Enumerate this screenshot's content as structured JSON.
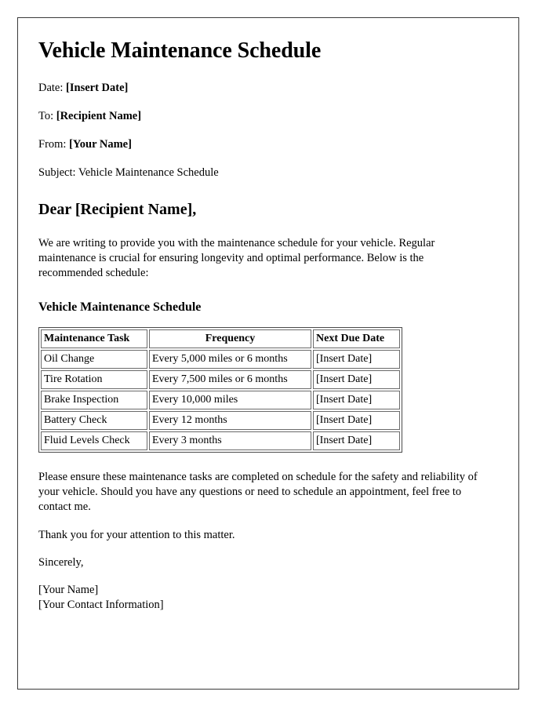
{
  "document": {
    "title": "Vehicle Maintenance Schedule",
    "meta": [
      {
        "label": "Date:",
        "value": "[Insert Date]",
        "bold": true
      },
      {
        "label": "To:",
        "value": "[Recipient Name]",
        "bold": true
      },
      {
        "label": "From:",
        "value": "[Your Name]",
        "bold": true
      },
      {
        "label": "Subject:",
        "value": "Vehicle Maintenance Schedule",
        "bold": false
      }
    ],
    "salutation": "Dear [Recipient Name],",
    "intro_paragraph": "We are writing to provide you with the maintenance schedule for your vehicle. Regular maintenance is crucial for ensuring longevity and optimal performance. Below is the recommended schedule:",
    "table_heading": "Vehicle Maintenance Schedule",
    "table": {
      "columns": [
        "Maintenance Task",
        "Frequency",
        "Next Due Date"
      ],
      "rows": [
        [
          "Oil Change",
          "Every 5,000 miles or 6 months",
          "[Insert Date]"
        ],
        [
          "Tire Rotation",
          "Every 7,500 miles or 6 months",
          "[Insert Date]"
        ],
        [
          "Brake Inspection",
          "Every 10,000 miles",
          "[Insert Date]"
        ],
        [
          "Battery Check",
          "Every 12 months",
          "[Insert Date]"
        ],
        [
          "Fluid Levels Check",
          "Every 3 months",
          "[Insert Date]"
        ]
      ]
    },
    "closing_paragraph": "Please ensure these maintenance tasks are completed on schedule for the safety and reliability of your vehicle. Should you have any questions or need to schedule an appointment, feel free to contact me.",
    "thanks_paragraph": "Thank you for your attention to this matter.",
    "sign_off": "Sincerely,",
    "signature_name": "[Your Name]",
    "signature_contact": "[Your Contact Information]"
  }
}
